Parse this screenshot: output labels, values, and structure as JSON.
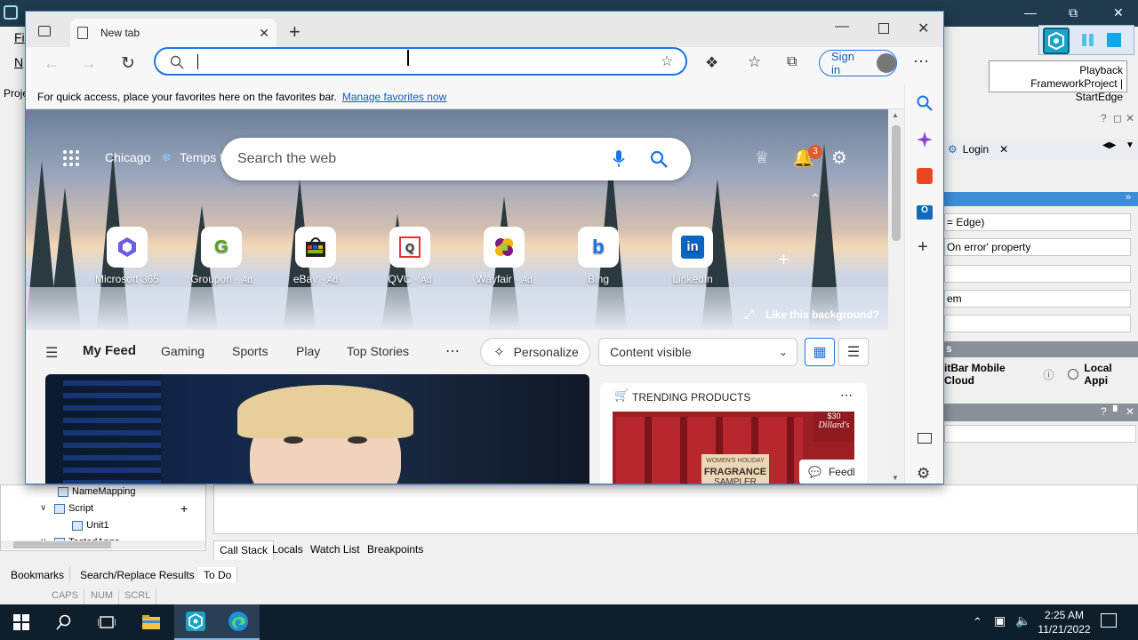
{
  "ide": {
    "menus": [
      "Fi",
      "N"
    ],
    "project_tab": "Proje",
    "playback_label": "Playback",
    "run_label": "FrameworkProject | StartEdge",
    "tree": {
      "name_mapping": "NameMapping",
      "script": "Script",
      "unit1": "Unit1",
      "tested_apps": "TestedApps"
    },
    "right_tab": "Login",
    "properties": {
      "row1": "= Edge)",
      "row2": "On error' property",
      "row4": "em",
      "section": "s",
      "mobile_cloud": "itBar Mobile Cloud",
      "local_app": "Local Appi"
    },
    "bottom_tabs": [
      "Call Stack",
      "Locals",
      "Watch List",
      "Breakpoints"
    ],
    "bottom_tabs2": [
      "Bookmarks",
      "Search/Replace Results",
      "To Do"
    ],
    "status": [
      "CAPS",
      "NUM",
      "SCRL"
    ]
  },
  "taskbar": {
    "time": "2:25 AM",
    "date": "11/21/2022"
  },
  "edge": {
    "tab_title": "New tab",
    "address_value": "",
    "sign_in": "Sign in",
    "favbar_text": "For quick access, place your favorites here on the favorites bar.",
    "favbar_link": "Manage favorites now",
    "location": "Chicago",
    "weather": "Temps t",
    "search_placeholder": "Search the web",
    "notification_count": "3",
    "quick_links": [
      {
        "label": "Microsoft 365",
        "ad": ""
      },
      {
        "label": "Groupon",
        "ad": "Ad"
      },
      {
        "label": "eBay",
        "ad": "Ad"
      },
      {
        "label": "QVC",
        "ad": "Ad"
      },
      {
        "label": "Wayfair",
        "ad": "Ad"
      },
      {
        "label": "Bing",
        "ad": ""
      },
      {
        "label": "LinkedIn",
        "ad": ""
      }
    ],
    "like_background": "Like this background?",
    "feed_tabs": [
      "My Feed",
      "Gaming",
      "Sports",
      "Play",
      "Top Stories"
    ],
    "personalize": "Personalize",
    "content_visible": "Content visible",
    "trending_title": "TRENDING PRODUCTS",
    "fragrance_text": "FRAGRANCE",
    "sampler_text": "SAMPLER",
    "womens_holiday": "WOMEN'S HOLIDAY",
    "price_tag": "$30",
    "dillards": "Dillard's",
    "feedback": "Feedback"
  },
  "colors": {
    "accent": "#1a73e8",
    "ide_title": "#1f3b4d",
    "taskbar": "#0e1e2b"
  }
}
